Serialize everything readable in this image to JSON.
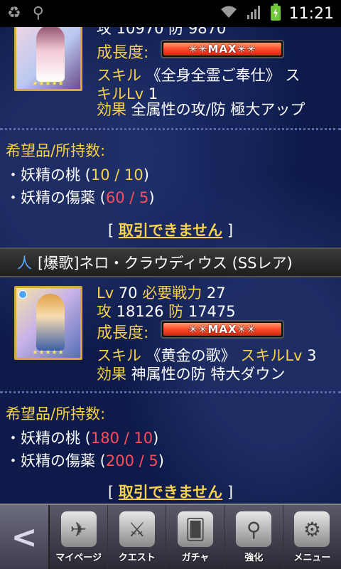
{
  "status": {
    "time": "11:21",
    "icons": [
      "recycle-icon",
      "usb-icon",
      "wifi-icon",
      "signal-icon",
      "battery-icon"
    ]
  },
  "cards": [
    {
      "atk_def_partial": "攻 10970 防 9870",
      "growth_label": "成長度:",
      "growth_value": "✳✳MAX✳✳",
      "skill_line1_key": "スキル",
      "skill_line1_val": " 《全身全霊ご奉仕》 ス",
      "skill_line2_key": "キルLv",
      "skill_line2_val": " 1",
      "effect_key": "効果",
      "effect_val": " 全属性の攻/防 極大アップ",
      "wanted_title": "希望品/所持数:",
      "wanted": [
        {
          "bullet": "・",
          "name": "妖精の桃 (",
          "count": "10 / 10",
          "close": ")",
          "ok": true
        },
        {
          "bullet": "・",
          "name": "妖精の傷薬 (",
          "count": "60 / 5",
          "close": ")",
          "ok": false
        }
      ],
      "trade_open": "[ ",
      "trade_label": "取引できません",
      "trade_close": " ]"
    },
    {
      "attr": "人",
      "title": "[爆歌]ネロ・クラウディウス (SSレア)",
      "lv_key": "Lv",
      "lv_val": " 70 ",
      "cost_key": "必要戦力",
      "cost_val": " 27",
      "atk_key": "攻",
      "atk_val": " 18126 ",
      "def_key": "防",
      "def_val": " 17475",
      "growth_label": "成長度:",
      "growth_value": "✳✳MAX✳✳",
      "skill_key": "スキル",
      "skill_val": " 《黄金の歌》 ",
      "skill_lv_key": "スキルLv",
      "skill_lv_val": " 3",
      "effect_key": "効果",
      "effect_val": " 神属性の防 特大ダウン",
      "wanted_title": "希望品/所持数:",
      "wanted": [
        {
          "bullet": "・",
          "name": "妖精の桃 (",
          "count": "180 / 10",
          "close": ")",
          "ok": false
        },
        {
          "bullet": "・",
          "name": "妖精の傷薬 (",
          "count": "200 / 5",
          "close": ")",
          "ok": false
        }
      ],
      "trade_open": "[ ",
      "trade_label": "取引できません",
      "trade_close": " ]"
    }
  ],
  "nav": {
    "back_icon": "chevron-left-icon",
    "items": [
      {
        "label": "マイページ",
        "icon": "mypage-icon"
      },
      {
        "label": "クエスト",
        "icon": "quest-icon"
      },
      {
        "label": "ガチャ",
        "icon": "gacha-icon"
      },
      {
        "label": "強化",
        "icon": "upgrade-icon"
      },
      {
        "label": "メニュー",
        "icon": "gear-icon"
      }
    ]
  },
  "colors": {
    "gold": "#f7d14a",
    "red": "#ff4d5a",
    "background": "#0d1a4a"
  }
}
